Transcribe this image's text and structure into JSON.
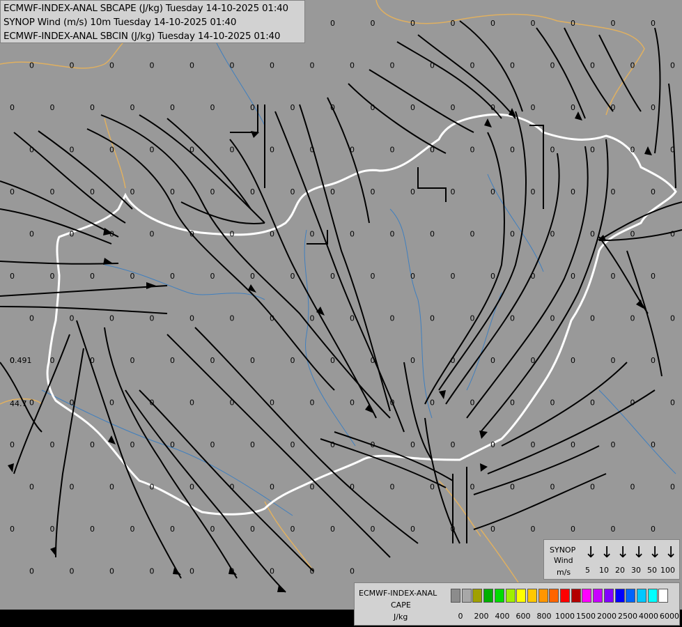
{
  "titles": {
    "line1": "ECMWF-INDEX-ANAL SBCAPE (J/kg) Tuesday 14-10-2025 01:40",
    "line2": "SYNOP Wind (m/s) 10m Tuesday 14-10-2025 01:40",
    "line3": "ECMWF-INDEX-ANAL SBCIN (J/kg) Tuesday 14-10-2025 01:40"
  },
  "wind_legend": {
    "title1": "SYNOP",
    "title2": "Wind",
    "unit": "m/s",
    "speeds": [
      "5",
      "10",
      "20",
      "30",
      "50",
      "100"
    ]
  },
  "cape_legend": {
    "title1": "ECMWF-INDEX-ANAL",
    "title2": "CAPE",
    "unit": "J/kg",
    "ticks": [
      "0",
      "200",
      "400",
      "600",
      "800",
      "1000",
      "1500",
      "2000",
      "2500",
      "4000",
      "6000"
    ],
    "colors": [
      "#8c8c8c",
      "#a8a8a8",
      "#a0a000",
      "#00b000",
      "#00dc00",
      "#a0f000",
      "#ffff00",
      "#ffc800",
      "#ff9600",
      "#ff6400",
      "#ff0000",
      "#b40000",
      "#ff00ff",
      "#c800ff",
      "#8200ff",
      "#0000ff",
      "#0064ff",
      "#00c8ff",
      "#00ffff",
      "#ffffff"
    ]
  },
  "field_labels": {
    "grid_value": "0",
    "extra_values": [
      "0.491",
      "44.7"
    ]
  },
  "map_colors": {
    "background": "#999999",
    "border": "#ffffff",
    "foreign_border": "#e0b060",
    "river": "#3f7fbf",
    "streamline": "#000000"
  }
}
